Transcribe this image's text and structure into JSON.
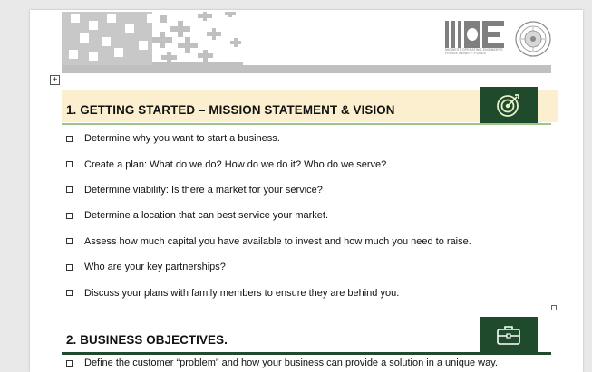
{
  "header": {
    "logo_tag": "Midwest Operating Engineers Fringe Benefit Funds"
  },
  "section1": {
    "title": "1.  GETTING STARTED – MISSION STATEMENT & VISION",
    "icon": "target-icon",
    "items": [
      "Determine why you want to start a business.",
      "Create a plan: What do we do? How do we do it? Who do we serve?",
      "Determine viability: Is there a market for your service?",
      "Determine a location that can best service your market.",
      "Assess how much capital you have available to invest and how much you need to raise.",
      "Who are your key partnerships?",
      "Discuss your plans with family members to ensure they are behind you."
    ]
  },
  "section2": {
    "title": "2.  BUSINESS OBJECTIVES.",
    "icon": "briefcase-icon",
    "first_item": "Define the customer “problem” and how your business can provide a solution in a unique way."
  },
  "colors": {
    "header_bar": "#c0c0c0",
    "section_band": "#fcefcf",
    "accent_green": "#1f4a2b",
    "light_green_line": "#9fc48a"
  }
}
